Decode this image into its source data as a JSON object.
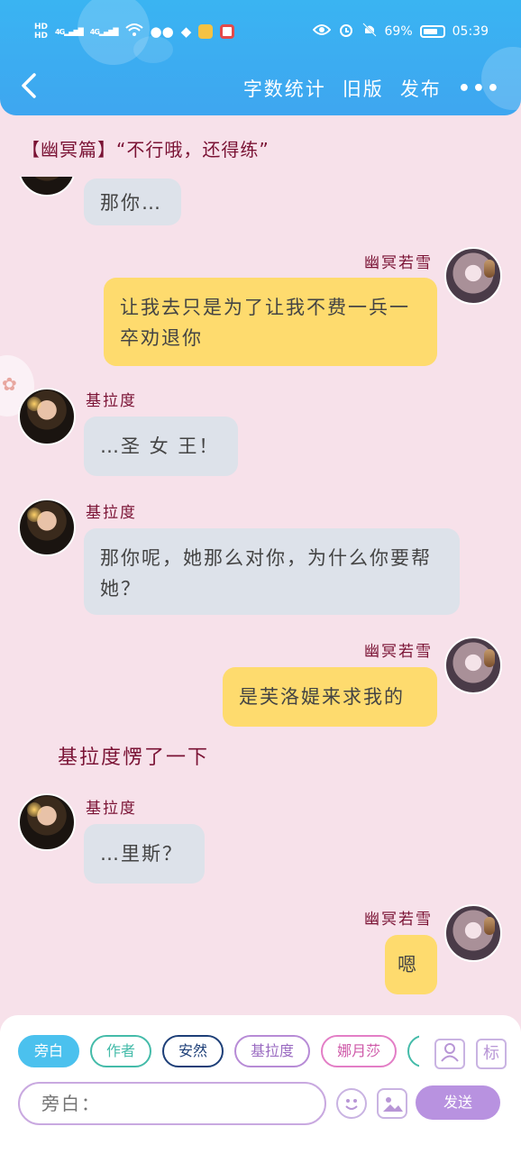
{
  "status_bar": {
    "hd_top": "HD",
    "hd_bottom": "HD",
    "signal1": "4G",
    "signal2": "4G",
    "battery": "69%",
    "time": "05:39"
  },
  "nav": {
    "word_count": "字数统计",
    "old_version": "旧版",
    "publish": "发布",
    "more": "•••"
  },
  "chapter_title": "【幽冥篇】“不行哦，还得练”",
  "messages": [
    {
      "side": "left",
      "speaker": "",
      "text": "那你…"
    },
    {
      "side": "right",
      "speaker": "幽冥若雪",
      "text": "让我去只是为了让我不费一兵一卒劝退你"
    },
    {
      "side": "left",
      "speaker": "基拉度",
      "text": "…圣 女 王！"
    },
    {
      "side": "left",
      "speaker": "基拉度",
      "text": "那你呢，她那么对你，为什么你要帮她？"
    },
    {
      "side": "right",
      "speaker": "幽冥若雪",
      "text": "是芙洛媞来求我的"
    },
    {
      "side": "narration",
      "text": "基拉度愣了一下"
    },
    {
      "side": "left",
      "speaker": "基拉度",
      "text": "…里斯？"
    },
    {
      "side": "right",
      "speaker": "幽冥若雪",
      "text": "嗯"
    }
  ],
  "chips": [
    {
      "label": "旁白",
      "color": "#4bc1ee",
      "active": true
    },
    {
      "label": "作者",
      "color": "#44bba9",
      "active": false
    },
    {
      "label": "安然",
      "color": "#1d3f78",
      "active": false
    },
    {
      "label": "基拉度",
      "color": "#b78bd6",
      "active": false
    },
    {
      "label": "娜月莎",
      "color": "#e37ec6",
      "active": false
    },
    {
      "label": "",
      "color": "#44bba9",
      "active": false
    }
  ],
  "input": {
    "placeholder": "旁白："
  },
  "toolbar": {
    "tag_label": "标",
    "send_label": "发送"
  },
  "icons": {
    "back": "chevron-left-icon",
    "eye": "eye-icon",
    "alarm": "alarm-icon",
    "mute": "bell-off-icon",
    "role": "person-card-icon",
    "emoji": "smile-icon",
    "image": "image-icon"
  }
}
